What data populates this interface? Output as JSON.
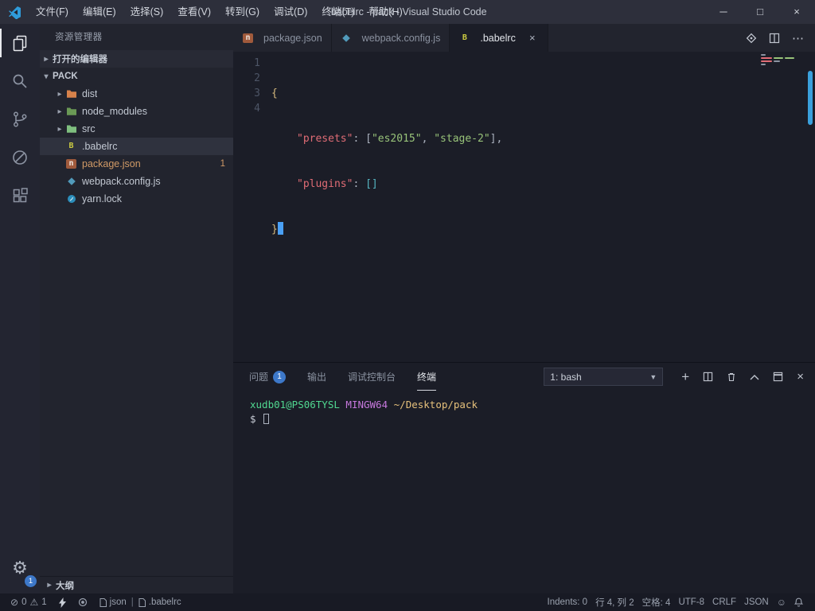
{
  "title_bar": {
    "menus": [
      "文件(F)",
      "编辑(E)",
      "选择(S)",
      "查看(V)",
      "转到(G)",
      "调试(D)",
      "终端(T)",
      "帮助(H)"
    ],
    "title": ".babelrc - pack - Visual Studio Code",
    "minimize": "─",
    "maximize": "□",
    "close": "×"
  },
  "activity_bar": {
    "settings_badge": "1"
  },
  "sidebar": {
    "title": "资源管理器",
    "sections": {
      "open_editors": "打开的编辑器",
      "project": "PACK",
      "outline": "大纲"
    },
    "folders": [
      "dist",
      "node_modules",
      "src"
    ],
    "files": [
      {
        "name": ".babelrc"
      },
      {
        "name": "package.json",
        "badge": "1"
      },
      {
        "name": "webpack.config.js"
      },
      {
        "name": "yarn.lock"
      }
    ]
  },
  "tabs": [
    {
      "label": "package.json"
    },
    {
      "label": "webpack.config.js"
    },
    {
      "label": ".babelrc"
    }
  ],
  "editor": {
    "line_numbers": [
      "1",
      "2",
      "3",
      "4"
    ],
    "code": {
      "l1_open": "{",
      "l2_key": "\"presets\"",
      "l2_colon": ": ",
      "l2_open": "[",
      "l2_str1": "\"es2015\"",
      "l2_sep": ", ",
      "l2_str2": "\"stage-2\"",
      "l2_close": "]",
      "l2_comma": ",",
      "l3_key": "\"plugins\"",
      "l3_colon": ": ",
      "l3_arr": "[]",
      "l4_close": "}"
    }
  },
  "panel": {
    "tabs": [
      "问题",
      "输出",
      "调试控制台",
      "终端"
    ],
    "problems_badge": "1",
    "terminal_dropdown": "1: bash",
    "terminal": {
      "user": "xudb01@PS06TYSL",
      "shell": "MINGW64",
      "path": "~/Desktop/pack",
      "prompt": "$"
    }
  },
  "status_bar": {
    "errors": "0",
    "warnings": "1",
    "language_left": "json",
    "separator": "|",
    "file_left": ".babelrc",
    "indents": "Indents: 0",
    "cursor": "行 4, 列 2",
    "spaces": "空格: 4",
    "encoding": "UTF-8",
    "eol": "CRLF",
    "language": "JSON",
    "smiley": "☺"
  }
}
